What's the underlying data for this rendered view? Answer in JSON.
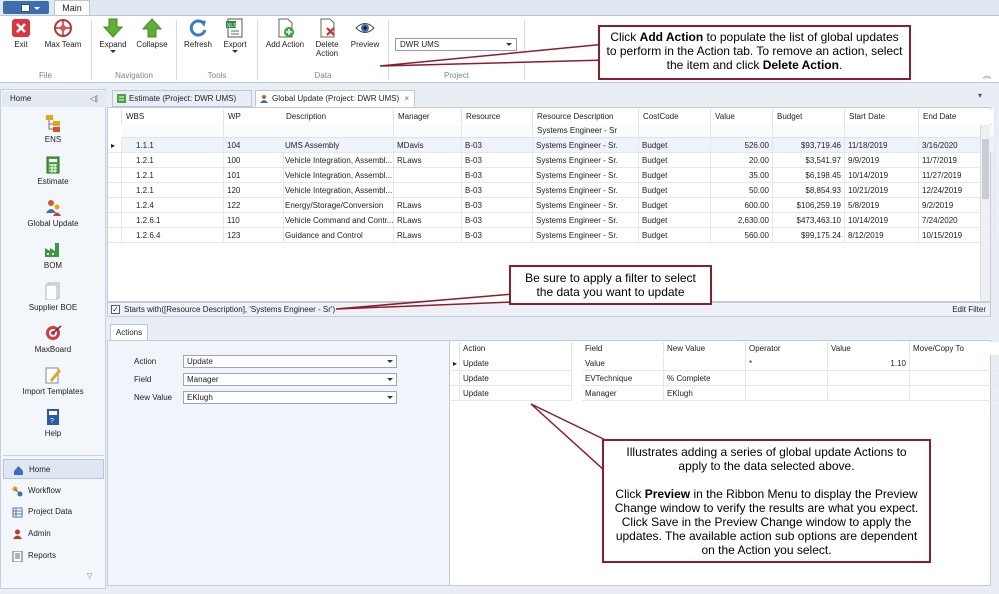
{
  "ribbon": {
    "tab": "Main",
    "buttons": {
      "exit": "Exit",
      "maxteam": "Max Team",
      "expand": "Expand",
      "collapse": "Collapse",
      "refresh": "Refresh",
      "export": "Export",
      "add_action": "Add Action",
      "delete_action_1": "Delete",
      "delete_action_2": "Action",
      "preview": "Preview"
    },
    "groups": {
      "file": "File",
      "navigation": "Navigation",
      "tools": "Tools",
      "data": "Data",
      "project": "Project"
    },
    "project_value": "DWR UMS"
  },
  "sidebar": {
    "header": "Home",
    "items": [
      "ENS",
      "Estimate",
      "Global Update",
      "BOM",
      "Supplier BOE",
      "MaxBoard",
      "Import Templates",
      "Help"
    ],
    "bottom": [
      "Home",
      "Workflow",
      "Project Data",
      "Admin",
      "Reports"
    ]
  },
  "doc_tabs": [
    "Estimate (Project: DWR UMS)",
    "Global Update (Project: DWR UMS)"
  ],
  "grid": {
    "columns": [
      "WBS",
      "WP",
      "Description",
      "Manager",
      "Resource",
      "Resource Description",
      "CostCode",
      "Value",
      "Budget",
      "Start Date",
      "End Date"
    ],
    "filter_resource_desc": "Systems Engineer - Sr",
    "rows": [
      [
        "1.1.1",
        "104",
        "UMS Assembly",
        "MDavis",
        "B-03",
        "Systems Engineer - Sr.",
        "Budget",
        "526.00",
        "$93,719.46",
        "11/18/2019",
        "3/16/2020"
      ],
      [
        "1.2.1",
        "100",
        "Vehicle Integration, Assembl...",
        "RLaws",
        "B-03",
        "Systems Engineer - Sr.",
        "Budget",
        "20.00",
        "$3,541.97",
        "9/9/2019",
        "11/7/2019"
      ],
      [
        "1.2.1",
        "101",
        "Vehicle Integration, Assembl...",
        "",
        "B-03",
        "Systems Engineer - Sr.",
        "Budget",
        "35.00",
        "$6,198.45",
        "10/14/2019",
        "11/27/2019"
      ],
      [
        "1.2.1",
        "120",
        "Vehicle Integration, Assembl...",
        "",
        "B-03",
        "Systems Engineer - Sr.",
        "Budget",
        "50.00",
        "$8,854.93",
        "10/21/2019",
        "12/24/2019"
      ],
      [
        "1.2.4",
        "122",
        "Energy/Storage/Conversion",
        "RLaws",
        "B-03",
        "Systems Engineer - Sr.",
        "Budget",
        "600.00",
        "$106,259.19",
        "5/8/2019",
        "9/2/2019"
      ],
      [
        "1.2.6.1",
        "110",
        "Vehicle Command and Contr...",
        "RLaws",
        "B-03",
        "Systems Engineer - Sr.",
        "Budget",
        "2,630.00",
        "$473,463.10",
        "10/14/2019",
        "7/24/2020"
      ],
      [
        "1.2.6.4",
        "123",
        "Guidance and Control",
        "RLaws",
        "B-03",
        "Systems Engineer - Sr.",
        "Budget",
        "560.00",
        "$99,175.24",
        "8/12/2019",
        "10/15/2019"
      ]
    ],
    "filter_text": "Starts with([Resource Description], 'Systems Engineer - Sr')",
    "edit_filter": "Edit Filter"
  },
  "actions": {
    "tab": "Actions",
    "form": {
      "action_label": "Action",
      "action_value": "Update",
      "field_label": "Field",
      "field_value": "Manager",
      "newvalue_label": "New Value",
      "newvalue_value": "EKlugh"
    },
    "columns": [
      "Action",
      "Field",
      "New Value",
      "Operator",
      "Value",
      "Move/Copy To"
    ],
    "rows": [
      [
        "Update",
        "Value",
        "",
        "*",
        "1.10",
        ""
      ],
      [
        "Update",
        "EVTechnique",
        "% Complete",
        "",
        "",
        ""
      ],
      [
        "Update",
        "Manager",
        "EKlugh",
        "",
        "",
        ""
      ]
    ]
  },
  "callouts": {
    "c1_pre": "Click ",
    "c1_b1": "Add Action",
    "c1_mid": " to populate the list of global updates to perform in the Action tab. To remove an action, select the item and click ",
    "c1_b2": "Delete Action",
    "c1_end": ".",
    "c2": "Be sure to apply a filter to select the data you want to update",
    "c3_p1": "Illustrates adding a series of global update Actions to apply to the data selected above.",
    "c3_pre": "Click ",
    "c3_b": "Preview",
    "c3_post": " in the Ribbon Menu to display the Preview Change window to verify the results are what you expect. Click Save in the Preview Change window to apply the updates. The available action sub options are dependent on the Action you select."
  }
}
